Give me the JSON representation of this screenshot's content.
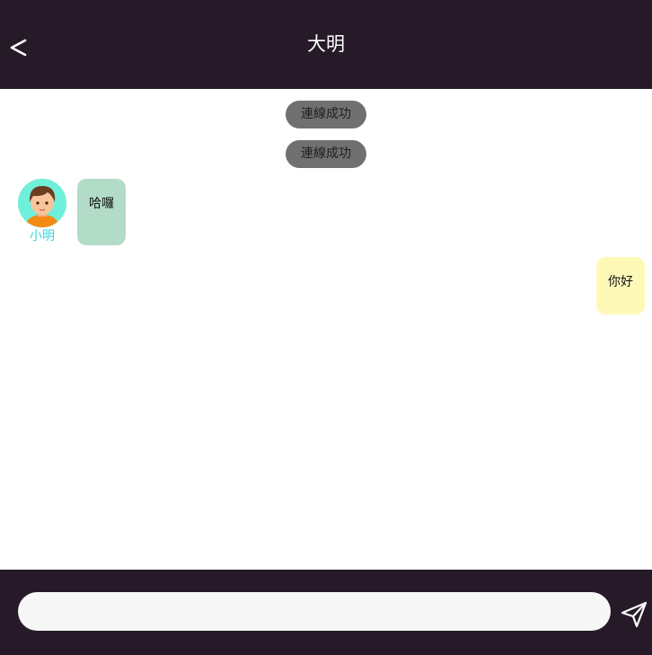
{
  "header": {
    "title": "大明"
  },
  "system_messages": [
    {
      "text": "連線成功"
    },
    {
      "text": "連線成功"
    }
  ],
  "incoming_message": {
    "sender_name": "小明",
    "text": "哈囉"
  },
  "outgoing_message": {
    "text": "你好"
  },
  "composer": {
    "placeholder": "",
    "value": ""
  },
  "colors": {
    "header_bg": "#261a28",
    "system_pill_bg": "#707070",
    "incoming_bubble_bg": "#b3dcc8",
    "outgoing_bubble_bg": "#fff9b8",
    "sender_name": "#30d8e6",
    "avatar_bg": "#6ff0da"
  },
  "icons": {
    "back": "back-arrow-icon",
    "send": "send-icon"
  }
}
